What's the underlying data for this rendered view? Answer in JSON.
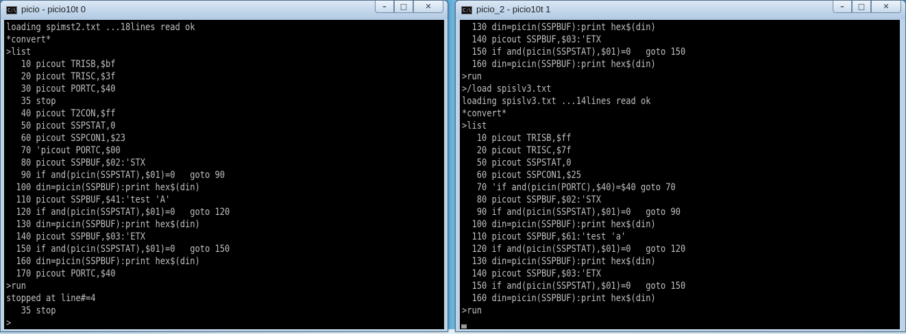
{
  "left_window": {
    "title": "picio - picio10t  0",
    "icon_label": "C:\\",
    "minimize": "–",
    "maximize": "□",
    "close": "✕",
    "lines": [
      "loading spimst2.txt ...18lines read ok",
      "*convert*",
      ">list",
      "   10 picout TRISB,$bf",
      "   20 picout TRISC,$3f",
      "   30 picout PORTC,$40",
      "   35 stop",
      "   40 picout T2CON,$ff",
      "   50 picout SSPSTAT,0",
      "   60 picout SSPCON1,$23",
      "   70 'picout PORTC,$00",
      "   80 picout SSPBUF,$02:'STX",
      "   90 if and(picin(SSPSTAT),$01)=0   goto 90",
      "  100 din=picin(SSPBUF):print hex$(din)",
      "  110 picout SSPBUF,$41:'test 'A'",
      "  120 if and(picin(SSPSTAT),$01)=0   goto 120",
      "  130 din=picin(SSPBUF):print hex$(din)",
      "  140 picout SSPBUF,$03:'ETX",
      "  150 if and(picin(SSPSTAT),$01)=0   goto 150",
      "  160 din=picin(SSPBUF):print hex$(din)",
      "  170 picout PORTC,$40",
      ">run",
      "stopped at line#=4",
      "   35 stop",
      ">"
    ]
  },
  "right_window": {
    "title": "picio_2 - picio10t  1",
    "icon_label": "C:\\",
    "minimize": "–",
    "maximize": "□",
    "close": "✕",
    "lines": [
      "  130 din=picin(SSPBUF):print hex$(din)",
      "  140 picout SSPBUF,$03:'ETX",
      "  150 if and(picin(SSPSTAT),$01)=0   goto 150",
      "  160 din=picin(SSPBUF):print hex$(din)",
      ">run",
      ">/load spislv3.txt",
      "loading spislv3.txt ...14lines read ok",
      "*convert*",
      ">list",
      "   10 picout TRISB,$ff",
      "   20 picout TRISC,$7f",
      "   50 picout SSPSTAT,0",
      "   60 picout SSPCON1,$25",
      "   70 'if and(picin(PORTC),$40)=$40 goto 70",
      "   80 picout SSPBUF,$02:'STX",
      "   90 if and(picin(SSPSTAT),$01)=0   goto 90",
      "  100 din=picin(SSPBUF):print hex$(din)",
      "  110 picout SSPBUF,$61:'test 'a'",
      "  120 if and(picin(SSPSTAT),$01)=0   goto 120",
      "  130 din=picin(SSPBUF):print hex$(din)",
      "  140 picout SSPBUF,$03:'ETX",
      "  150 if and(picin(SSPSTAT),$01)=0   goto 150",
      "  160 din=picin(SSPBUF):print hex$(din)",
      ">run"
    ]
  }
}
